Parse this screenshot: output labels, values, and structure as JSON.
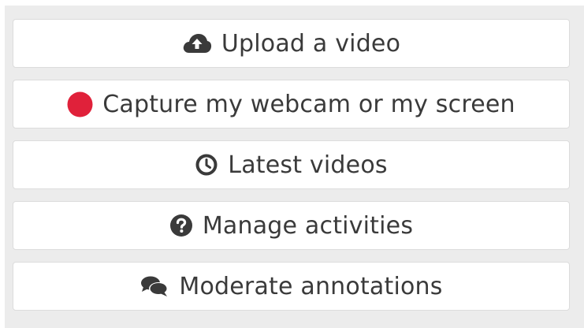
{
  "menu": {
    "items": [
      {
        "label": "Upload a video",
        "icon": "cloud-upload-icon"
      },
      {
        "label": "Capture my webcam or my screen",
        "icon": "record-dot-icon"
      },
      {
        "label": "Latest videos",
        "icon": "clock-icon"
      },
      {
        "label": "Manage activities",
        "icon": "question-circle-icon"
      },
      {
        "label": "Moderate annotations",
        "icon": "comments-icon"
      }
    ]
  },
  "colors": {
    "panel_background": "#ececec",
    "button_background": "#ffffff",
    "button_border": "#dcdcdc",
    "text": "#3a3a3a",
    "record_red": "#e0213a"
  }
}
